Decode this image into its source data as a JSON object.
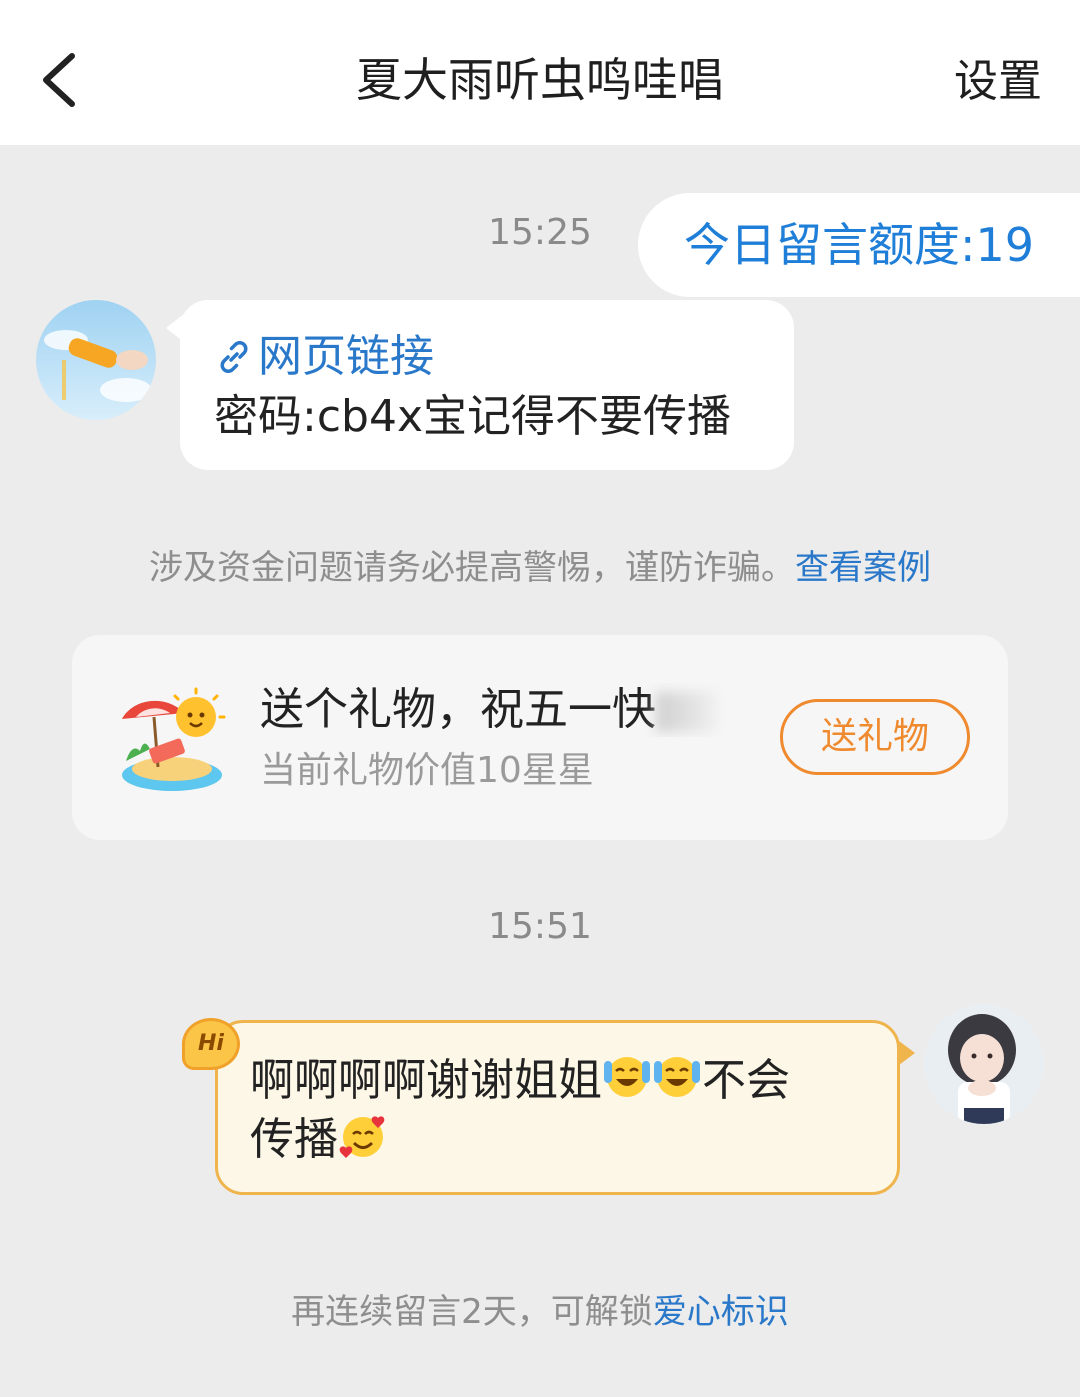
{
  "header": {
    "title": "夏大雨听虫鸣哇唱",
    "settings_label": "设置"
  },
  "messages": {
    "time_1": "15:25",
    "quota": "今日留言额度:19",
    "incoming": {
      "link_label": "网页链接",
      "text": "密码:cb4x宝记得不要传播"
    },
    "notice_text": "涉及资金问题请务必提高警惕，谨防诈骗。",
    "notice_link": "查看案例",
    "time_2": "15:51",
    "outgoing": {
      "badge": "Hi",
      "text_part1": "啊啊啊啊谢谢姐姐",
      "text_part2": "不会",
      "text_part3": "传播"
    }
  },
  "gift": {
    "title": "送个礼物，祝五一快",
    "subtitle": "当前礼物价值10星星",
    "button_label": "送礼物"
  },
  "footer": {
    "text": "再连续留言2天，可解锁",
    "link": "爱心标识"
  },
  "colors": {
    "link": "#2a78c9",
    "gift_accent": "#ef8a2e",
    "outgoing_border": "#f0b44d",
    "outgoing_fill": "#fdf7e8"
  }
}
